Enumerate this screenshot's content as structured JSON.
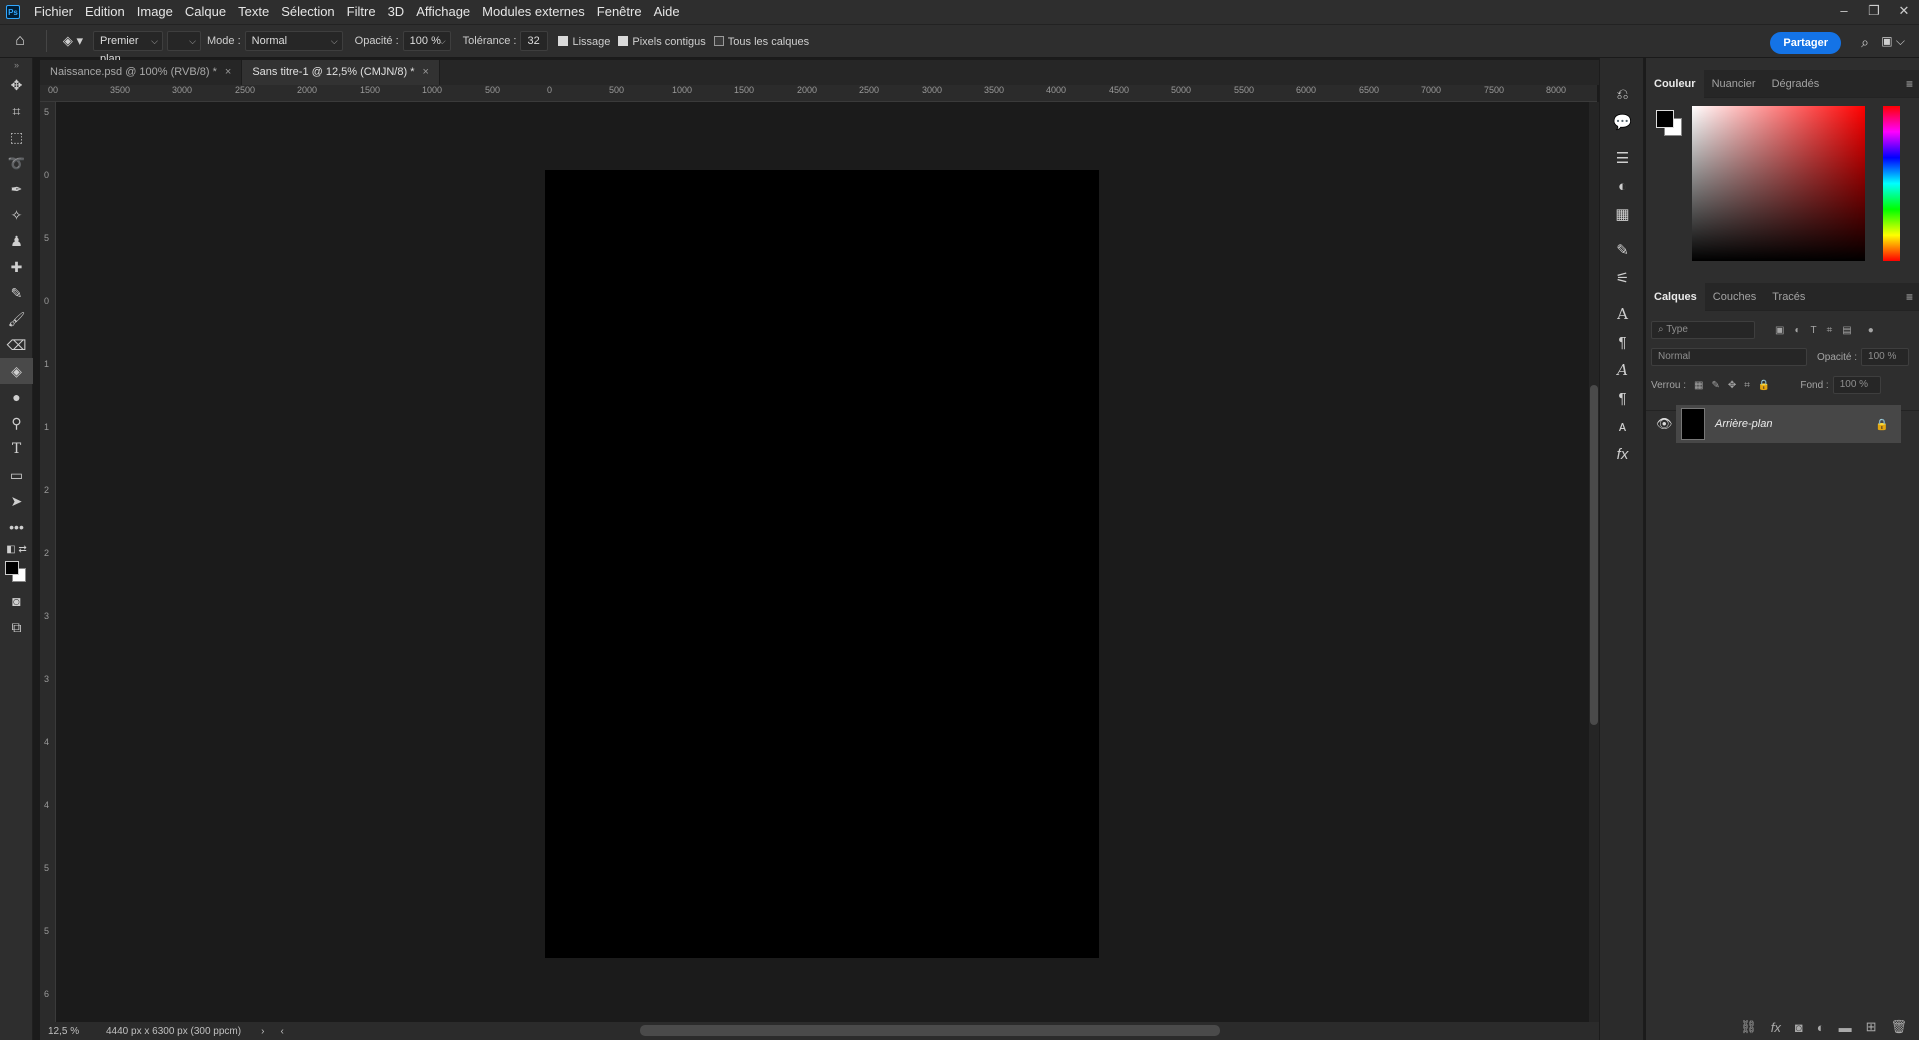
{
  "menubar": {
    "logo": "Ps",
    "items": [
      "Fichier",
      "Edition",
      "Image",
      "Calque",
      "Texte",
      "Sélection",
      "Filtre",
      "3D",
      "Affichage",
      "Modules externes",
      "Fenêtre",
      "Aide"
    ]
  },
  "optionsbar": {
    "fill_source": "Premier plan",
    "mode_label": "Mode :",
    "mode_value": "Normal",
    "opacity_label": "Opacité :",
    "opacity_value": "100 %",
    "tolerance_label": "Tolérance :",
    "tolerance_value": "32",
    "antialias_label": "Lissage",
    "contiguous_label": "Pixels contigus",
    "all_layers_label": "Tous les calques",
    "share_label": "Partager"
  },
  "tabs": [
    {
      "label": "Naissance.psd @ 100% (RVB/8) *",
      "active": false
    },
    {
      "label": "Sans titre-1 @ 12,5% (CMJN/8) *",
      "active": true
    }
  ],
  "ruler_h": [
    "00",
    "3500",
    "3000",
    "2500",
    "2000",
    "1500",
    "1000",
    "500",
    "0",
    "500",
    "1000",
    "1500",
    "2000",
    "2500",
    "3000",
    "3500",
    "4000",
    "4500",
    "5000",
    "5500",
    "6000",
    "6500",
    "7000",
    "7500",
    "8000"
  ],
  "ruler_v": [
    "5",
    "0",
    "5",
    "0",
    "1",
    "1",
    "2",
    "2",
    "3",
    "3",
    "4",
    "4",
    "5",
    "5",
    "6"
  ],
  "status": {
    "zoom": "12,5 %",
    "doc_info": "4440 px x 6300 px (300 ppcm)"
  },
  "color_panel": {
    "tabs": [
      "Couleur",
      "Nuancier",
      "Dégradés"
    ],
    "foreground": "#000000",
    "background": "#ffffff"
  },
  "layers_panel": {
    "tabs": [
      "Calques",
      "Couches",
      "Tracés"
    ],
    "filter_placeholder": "Type",
    "blend_mode": "Normal",
    "opacity_label": "Opacité :",
    "opacity_value": "100 %",
    "lock_label": "Verrou :",
    "fill_label": "Fond :",
    "fill_value": "100 %",
    "layers": [
      {
        "name": "Arrière-plan",
        "locked": true,
        "visible": true
      }
    ]
  },
  "colors": {
    "accent": "#1473e6",
    "canvas": "#000000",
    "workspace": "#1b1b1b"
  }
}
